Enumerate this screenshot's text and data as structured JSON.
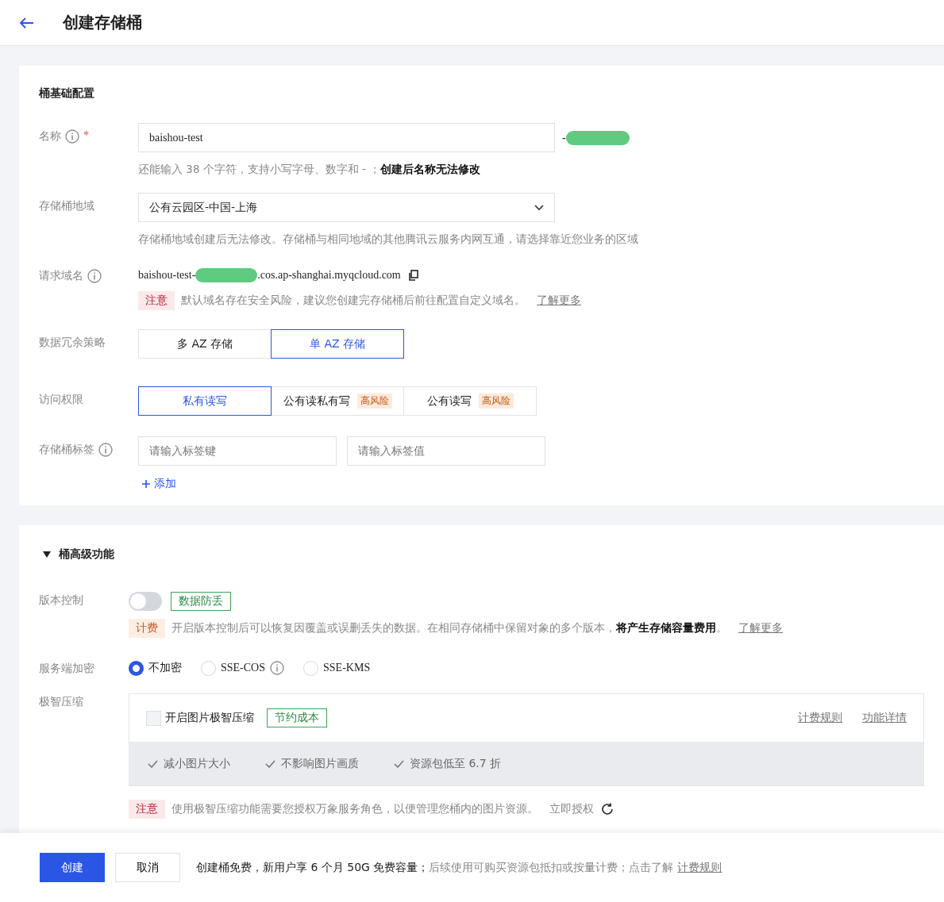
{
  "header": {
    "title": "创建存储桶"
  },
  "basic": {
    "title": "桶基础配置",
    "name": {
      "label": "名称",
      "info": true,
      "required_mark": "*",
      "value": "baishou-test",
      "suffix": "-",
      "hint": "还能输入 38 个字符，支持小写字母、数字和 - ；**创建后名称无法修改**"
    },
    "region": {
      "label": "存储桶地域",
      "value": "公有云园区-中国-上海",
      "hint": "存储桶地域创建后无法修改。存储桶与相同地域的其他腾讯云服务内网互通，请选择靠近您业务的区域"
    },
    "domain": {
      "label": "请求域名",
      "info": true,
      "prefix": "baishou-test-",
      "suffix": ".cos.ap-shanghai.myqcloud.com",
      "notice_tag": "注意",
      "notice": "默认域名存在安全风险，建议您创建完存储桶后前往配置自定义域名。",
      "link": "了解更多"
    },
    "redundancy": {
      "label": "数据冗余策略",
      "options": [
        {
          "label": "多 AZ 存储",
          "selected": false
        },
        {
          "label": "单 AZ 存储",
          "selected": true
        }
      ]
    },
    "access": {
      "label": "访问权限",
      "options": [
        {
          "label": "私有读写",
          "selected": true
        },
        {
          "label": "公有读私有写",
          "selected": false,
          "badge": "高风险"
        },
        {
          "label": "公有读写",
          "selected": false,
          "badge": "高风险"
        }
      ]
    },
    "tags": {
      "label": "存储桶标签",
      "info": true,
      "key_placeholder": "请输入标签键",
      "value_placeholder": "请输入标签值",
      "add": "添加"
    }
  },
  "advanced": {
    "title": "桶高级功能",
    "expanded": true,
    "versioning": {
      "label": "版本控制",
      "on": false,
      "badge": "数据防丢",
      "fee_tag": "计费",
      "note": "开启版本控制后可以恢复因覆盖或误删丢失的数据。在相同存储桶中保留对象的多个版本，**将产生存储容量费用**。",
      "link": "了解更多"
    },
    "encryption": {
      "label": "服务端加密",
      "options": [
        {
          "label": "不加密",
          "selected": true,
          "info": false
        },
        {
          "label": "SSE-COS",
          "selected": false,
          "info": true
        },
        {
          "label": "SSE-KMS",
          "selected": false,
          "info": false
        }
      ]
    },
    "compression": {
      "label": "极智压缩",
      "checked": false,
      "checkbox_label": "开启图片极智压缩",
      "badge": "节约成本",
      "links": [
        "计费规则",
        "功能详情"
      ],
      "benefits": [
        "减小图片大小",
        "不影响图片画质",
        "资源包低至 6.7 折"
      ],
      "notice_tag": "注意",
      "notice": "使用极智压缩功能需要您授权万象服务角色，以便管理您桶内的图片资源。",
      "link": "立即授权"
    }
  },
  "footer": {
    "create": "创建",
    "cancel": "取消",
    "highlight": "创建桶免费，新用户享 6 个月 50G 免费容量；",
    "text": "后续使用可购买资源包抵扣或按量计费；点击了解",
    "link": "计费规则"
  }
}
